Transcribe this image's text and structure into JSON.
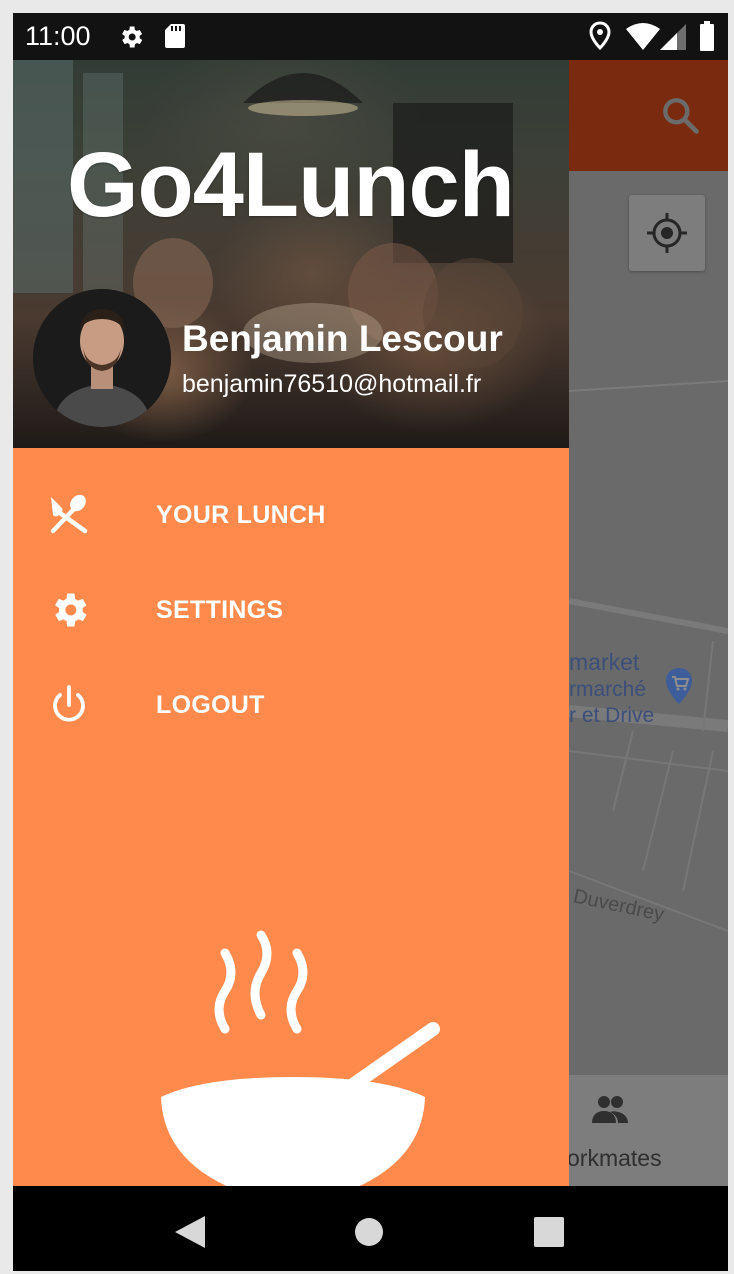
{
  "status_bar": {
    "time": "11:00"
  },
  "drawer": {
    "app_title": "Go4Lunch",
    "user": {
      "name": "Benjamin Lescour",
      "email": "benjamin76510@hotmail.fr"
    },
    "menu": [
      {
        "label": "YOUR LUNCH",
        "icon": "fork-spoon-icon"
      },
      {
        "label": "SETTINGS",
        "icon": "gear-icon"
      },
      {
        "label": "LOGOUT",
        "icon": "power-icon"
      }
    ]
  },
  "background_app": {
    "map_labels": {
      "poi_line1": "market",
      "poi_line2": "rmarché",
      "poi_line3": "r et Drive",
      "street": "t Duverdrey"
    },
    "bottom_nav": {
      "workmates_label": "orkmates"
    }
  },
  "colors": {
    "drawer": "#ff8a4b",
    "toolbar_dimmed": "#7a2a0e",
    "status_bar": "#121212",
    "nav_bar": "#000000"
  }
}
